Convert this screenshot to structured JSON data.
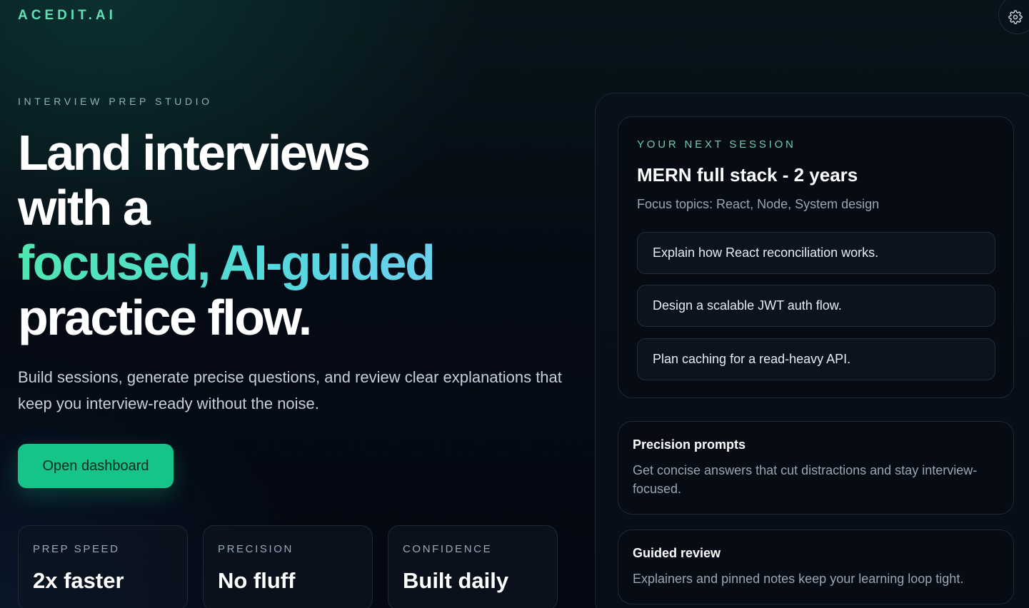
{
  "brand": "ACEDIT.AI",
  "icons": {
    "settings": "gear-icon"
  },
  "hero": {
    "eyebrow": "INTERVIEW PREP STUDIO",
    "headline_line1": "Land interviews",
    "headline_line2": "with a",
    "headline_accent": "focused, AI-guided",
    "headline_line4": "practice flow.",
    "subcopy": "Build sessions, generate precise questions, and review clear explanations that keep you interview-ready without the noise.",
    "cta_label": "Open dashboard"
  },
  "stats": [
    {
      "label": "PREP SPEED",
      "value": "2x faster"
    },
    {
      "label": "PRECISION",
      "value": "No fluff"
    },
    {
      "label": "CONFIDENCE",
      "value": "Built daily"
    }
  ],
  "session": {
    "eyebrow": "YOUR NEXT SESSION",
    "title": "MERN full stack - 2 years",
    "topics": "Focus topics: React, Node, System design",
    "questions": [
      "Explain how React reconciliation works.",
      "Design a scalable JWT auth flow.",
      "Plan caching for a read-heavy API."
    ]
  },
  "features": [
    {
      "title": "Precision prompts",
      "desc": "Get concise answers that cut distractions and stay interview-focused."
    },
    {
      "title": "Guided review",
      "desc": "Explainers and pinned notes keep your learning loop tight."
    }
  ],
  "colors": {
    "accent": "#16c489",
    "brand": "#5ee0b4",
    "gradient_start": "#4fe6b0",
    "gradient_end": "#7ec8ff",
    "background": "#050b14"
  }
}
